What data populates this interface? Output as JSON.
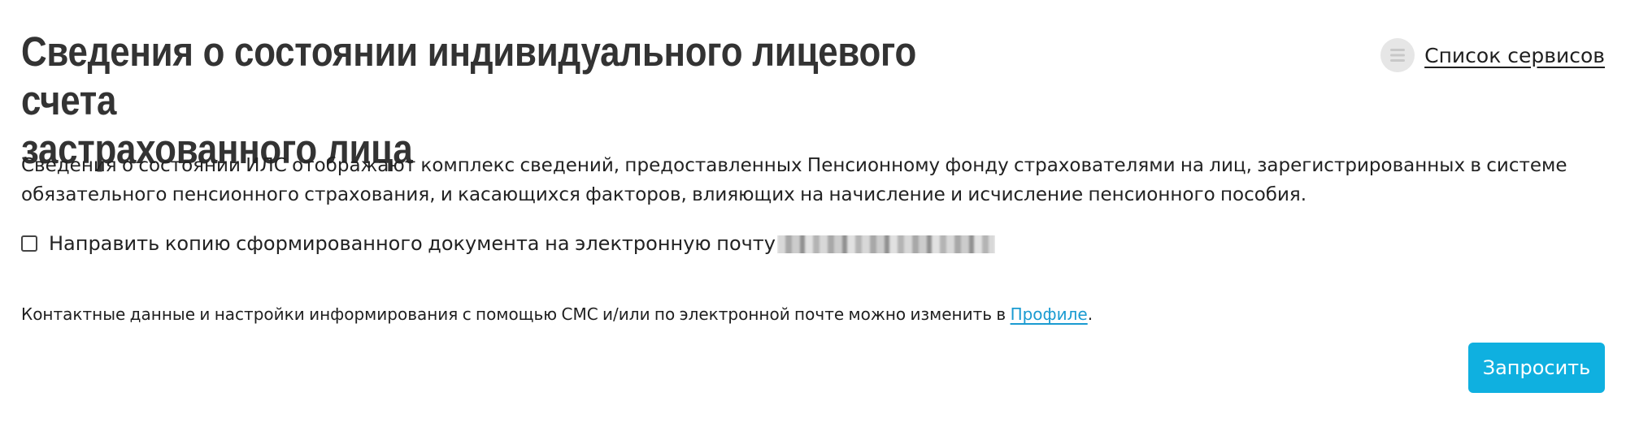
{
  "header": {
    "title_line1": "Сведения о состоянии индивидуального лицевого счета",
    "title_line2": "застрахованного лица",
    "services_link_label": "Список сервисов",
    "services_icon": "list-menu-icon"
  },
  "description": {
    "line1": "Сведения о состоянии ИЛС отображают комплекс сведений, предоставленных Пенсионному фонду страхователями на лиц, зарегистрированных в системе",
    "line2": "обязательного пенсионного страхования, и касающихся факторов, влияющих на начисление и исчисление пенсионного пособия."
  },
  "email_option": {
    "label": "Направить копию сформированного документа на электронную почту",
    "checked": false
  },
  "contacts_note": {
    "text": "Контактные данные и настройки информирования с помощью СМС и/или по электронной почте можно изменить в",
    "link_label": "Профиле",
    "suffix": "."
  },
  "actions": {
    "submit_label": "Запросить"
  },
  "colors": {
    "accent": "#0fb0e0",
    "link": "#1a9bd1",
    "title": "#333333"
  }
}
